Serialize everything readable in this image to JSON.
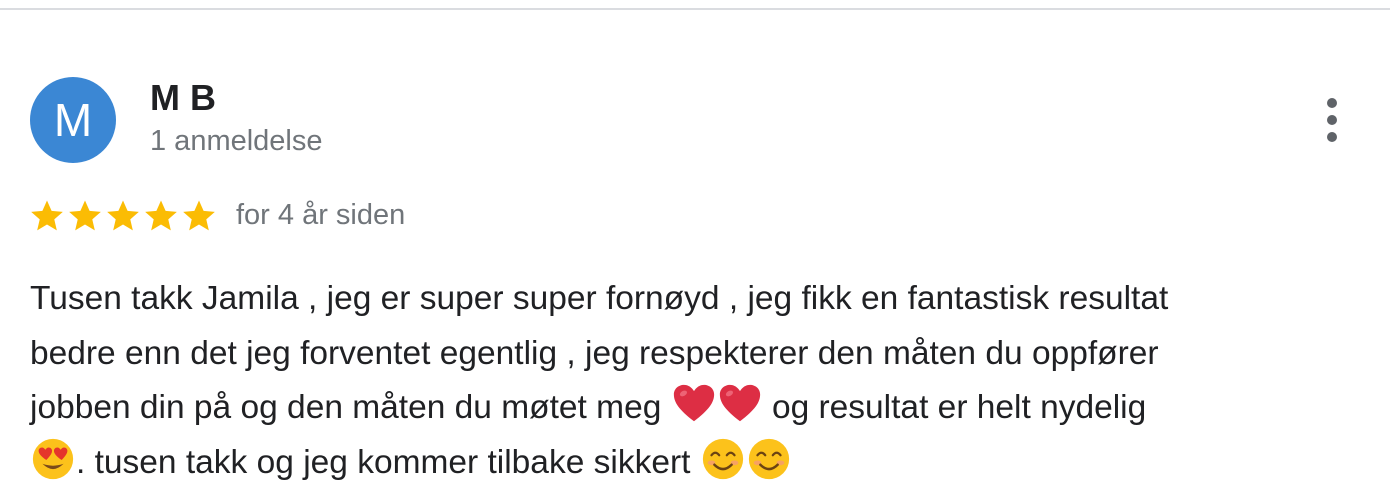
{
  "review": {
    "avatar_letter": "M",
    "avatar_color": "#3b87d4",
    "reviewer_name": "M B",
    "review_count": "1 anmeldelse",
    "rating": 5,
    "rating_max": 5,
    "star_color": "#fbbc04",
    "timestamp": "for 4 år siden",
    "text_lines": [
      "Tusen takk Jamila , jeg er super super fornøyd , jeg fikk en fantastisk resultat",
      "bedre enn det jeg forventet egentlig , jeg respekterer den måten du oppfører",
      "jobben din på og den måten du møtet meg ",
      " og resultat er helt nydelig",
      ". tusen takk og jeg kommer tilbake sikkert "
    ],
    "emoji_icons": [
      "red-heart-icon",
      "red-heart-icon",
      "heart-eyes-face-icon",
      "smiling-face-icon",
      "smiling-face-icon"
    ]
  },
  "icons": {
    "more_options": "vertical-ellipsis-icon",
    "star": "star-icon"
  }
}
